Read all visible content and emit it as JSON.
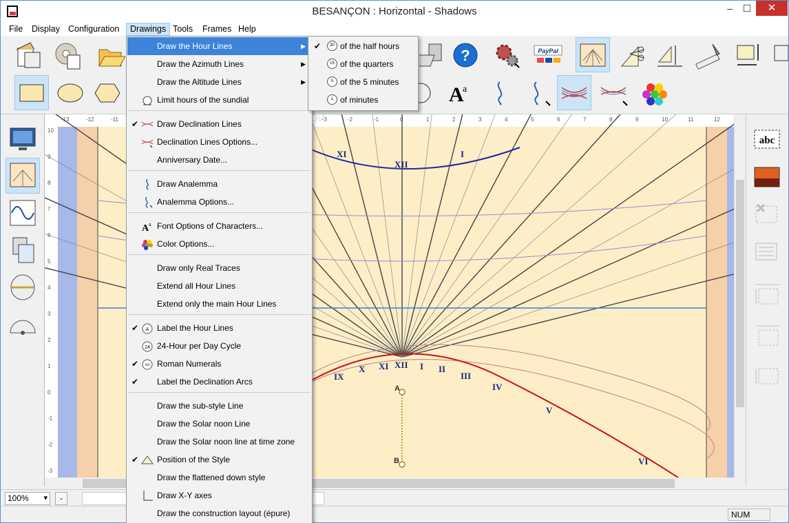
{
  "window": {
    "title": "BESANÇON : Horizontal - Shadows",
    "minimize": "–",
    "maximize": "☐",
    "close": "✕"
  },
  "menubar": [
    "File",
    "Display",
    "Configuration",
    "Drawings",
    "Tools",
    "Frames",
    "Help"
  ],
  "drawings_menu": {
    "items": [
      {
        "label": "Draw the Hour Lines",
        "checked": false,
        "submenu": true,
        "highlighted": true,
        "icon": ""
      },
      {
        "label": "Draw the Azimuth Lines",
        "checked": false,
        "submenu": true,
        "icon": ""
      },
      {
        "label": "Draw the Altitude Lines",
        "checked": false,
        "submenu": true,
        "icon": ""
      },
      {
        "label": "Limit hours of the sundial",
        "checked": false,
        "icon": "limit-hours-icon"
      },
      {
        "label": "Draw Declination Lines",
        "checked": true,
        "icon": "declination-icon"
      },
      {
        "label": "Declination Lines Options...",
        "checked": false,
        "icon": "declination-options-icon"
      },
      {
        "label": "Anniversary Date...",
        "checked": false,
        "icon": ""
      },
      {
        "label": "Draw Analemma",
        "checked": false,
        "icon": "analemma-icon"
      },
      {
        "label": "Analemma Options...",
        "checked": false,
        "icon": "analemma-options-icon"
      },
      {
        "label": "Font Options of Characters...",
        "checked": false,
        "icon": "font-icon"
      },
      {
        "label": "Color Options...",
        "checked": false,
        "icon": "color-icon"
      },
      {
        "label": "Draw only Real Traces",
        "checked": false,
        "icon": ""
      },
      {
        "label": "Extend all Hour Lines",
        "checked": false,
        "icon": ""
      },
      {
        "label": "Extend only the main Hour Lines",
        "checked": false,
        "icon": ""
      },
      {
        "label": "Label the Hour Lines",
        "checked": true,
        "icon": "label-hours-icon"
      },
      {
        "label": "24-Hour per Day Cycle",
        "checked": false,
        "icon": "24h-icon"
      },
      {
        "label": "Roman Numerals",
        "checked": true,
        "icon": "roman-icon"
      },
      {
        "label": "Label the Declination Arcs",
        "checked": true,
        "icon": ""
      },
      {
        "label": "Draw the sub-style Line",
        "checked": false,
        "icon": ""
      },
      {
        "label": "Draw the Solar noon Line",
        "checked": false,
        "icon": ""
      },
      {
        "label": "Draw the Solar noon line at time zone",
        "checked": false,
        "icon": ""
      },
      {
        "label": "Position of the Style",
        "checked": true,
        "icon": "style-position-icon"
      },
      {
        "label": "Draw the flattened down style",
        "checked": false,
        "icon": ""
      },
      {
        "label": "Draw X-Y axes",
        "checked": false,
        "icon": "xy-axes-icon"
      },
      {
        "label": "Draw the construction layout (épure)",
        "checked": false,
        "icon": ""
      }
    ]
  },
  "hour_lines_submenu": [
    {
      "label": "of the half hours",
      "checked": true,
      "badge": "30"
    },
    {
      "label": "of the quarters",
      "checked": false,
      "badge": "15"
    },
    {
      "label": "of the 5 minutes",
      "checked": false,
      "badge": "5"
    },
    {
      "label": "of minutes",
      "checked": false,
      "badge": "1"
    }
  ],
  "canvas": {
    "hour_labels_top": [
      "XI",
      "XII",
      "I"
    ],
    "hour_labels_bottom": [
      "IX",
      "X",
      "XI",
      "XII",
      "I",
      "II",
      "III",
      "IV",
      "V",
      "VI"
    ],
    "style_points": [
      "A",
      "B"
    ],
    "ruler_top": [
      "-13",
      "-12",
      "-11",
      "-3",
      "-2",
      "-1",
      "0",
      "1",
      "2",
      "3",
      "4",
      "5",
      "6",
      "7",
      "8",
      "9",
      "10",
      "11",
      "12"
    ],
    "ruler_left": [
      "10",
      "9",
      "8",
      "7",
      "6",
      "5",
      "4",
      "3",
      "2",
      "1",
      "0",
      "-1",
      "-2",
      "-3"
    ]
  },
  "toolbar": {
    "paypal": "PayPal",
    "help_icon": "?"
  },
  "status": {
    "zoom": "100%",
    "minus": "-",
    "num": "NUM"
  },
  "watermark": "SOFTPEDIA"
}
